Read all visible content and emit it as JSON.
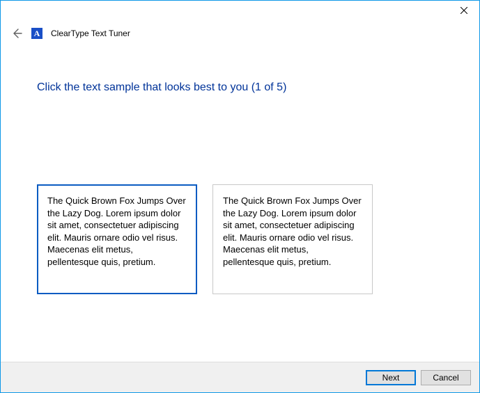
{
  "window_title": "ClearType Text Tuner",
  "app_icon_letter": "A",
  "heading": "Click the text sample that looks best to you (1 of 5)",
  "samples": {
    "left": "The Quick Brown Fox Jumps Over the Lazy Dog. Lorem ipsum dolor sit amet, consectetuer adipiscing elit. Mauris ornare odio vel risus. Maecenas elit metus, pellentesque quis, pretium.",
    "right": "The Quick Brown Fox Jumps Over the Lazy Dog. Lorem ipsum dolor sit amet, consectetuer adipiscing elit. Mauris ornare odio vel risus. Maecenas elit metus, pellentesque quis, pretium."
  },
  "buttons": {
    "next": "Next",
    "cancel": "Cancel"
  }
}
